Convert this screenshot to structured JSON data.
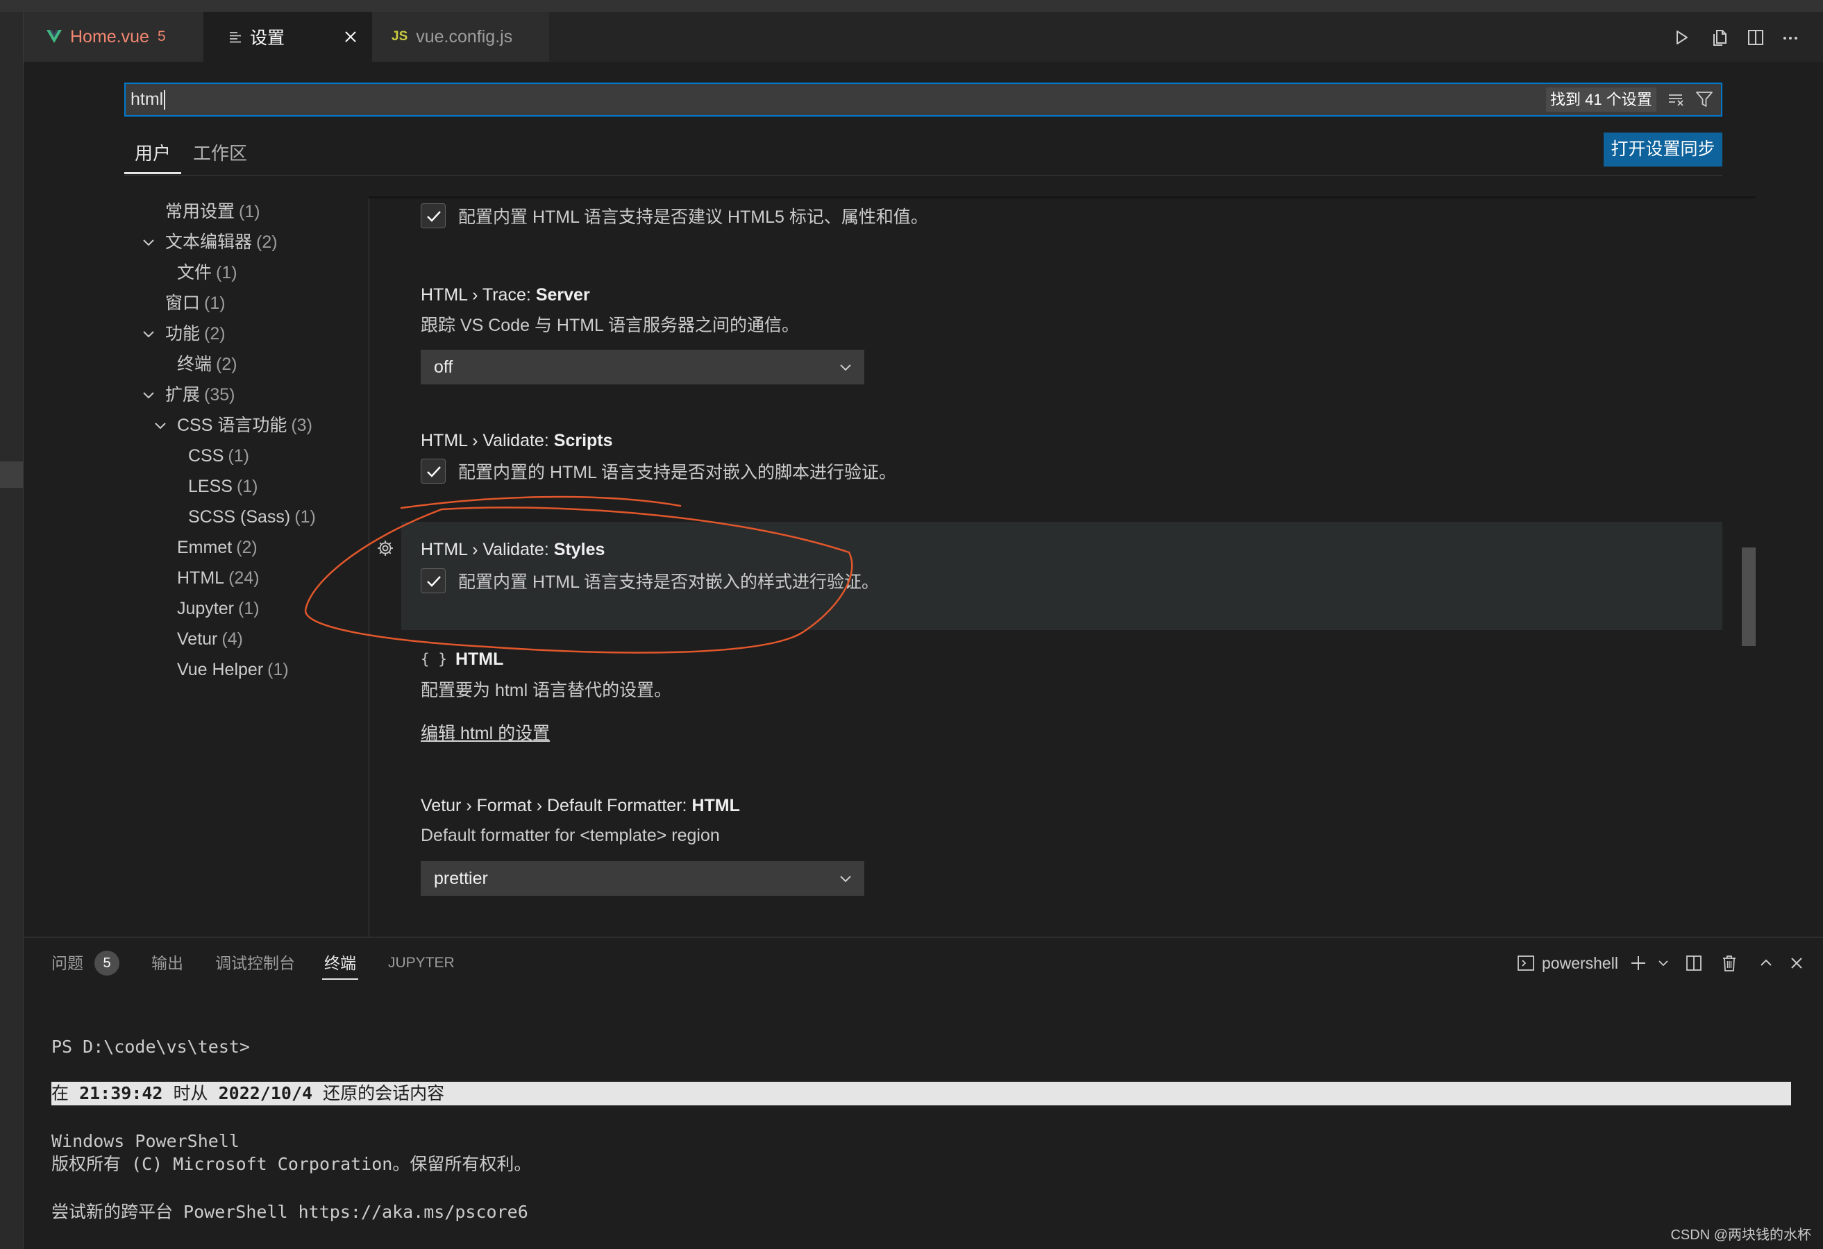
{
  "editor_tabs": [
    {
      "icon": "vue-icon",
      "label": "Home.vue",
      "problems": "5"
    },
    {
      "icon": "settings-list-icon",
      "label": "设置"
    },
    {
      "icon": "js-icon",
      "icon_text": "JS",
      "label": "vue.config.js"
    }
  ],
  "editor_actions": [
    "run-icon",
    "open-settings-json-icon",
    "split-editor-icon",
    "more-actions-icon"
  ],
  "search": {
    "value": "html",
    "result_count": "找到 41 个设置",
    "actions": [
      "clear-filter-icon",
      "filter-icon"
    ]
  },
  "scope_tabs": {
    "active_index": 0,
    "items": [
      "用户",
      "工作区"
    ]
  },
  "sync_button": {
    "label": "打开设置同步"
  },
  "toc": [
    {
      "label": "常用设置",
      "count": "(1)"
    },
    {
      "label": "文本编辑器",
      "count": "(2)",
      "expanded": true
    },
    {
      "label": "文件",
      "count": "(1)"
    },
    {
      "label": "窗口",
      "count": "(1)"
    },
    {
      "label": "功能",
      "count": "(2)",
      "expanded": true
    },
    {
      "label": "终端",
      "count": "(2)"
    },
    {
      "label": "扩展",
      "count": "(35)",
      "expanded": true
    },
    {
      "label": "CSS 语言功能",
      "count": "(3)",
      "expanded": true
    },
    {
      "label": "CSS",
      "count": "(1)"
    },
    {
      "label": "LESS",
      "count": "(1)"
    },
    {
      "label": "SCSS (Sass)",
      "count": "(1)"
    },
    {
      "label": "Emmet",
      "count": "(2)"
    },
    {
      "label": "HTML",
      "count": "(24)"
    },
    {
      "label": "Jupyter",
      "count": "(1)"
    },
    {
      "label": "Vetur",
      "count": "(4)"
    },
    {
      "label": "Vue Helper",
      "count": "(1)"
    }
  ],
  "settings": [
    {
      "description": "配置内置 HTML 语言支持是否建议 HTML5 标记、属性和值。",
      "checked": true
    },
    {
      "category": "HTML › Trace:",
      "key": "Server",
      "description": "跟踪 VS Code 与 HTML 语言服务器之间的通信。",
      "value": "off"
    },
    {
      "category": "HTML › Validate:",
      "key": "Scripts",
      "description": "配置内置的 HTML 语言支持是否对嵌入的脚本进行验证。",
      "checked": true
    },
    {
      "category": "HTML › Validate:",
      "key": "Styles",
      "description": "配置内置 HTML 语言支持是否对嵌入的样式进行验证。",
      "checked": true,
      "hovered": true
    },
    {
      "braces": "{ }",
      "key": "HTML",
      "description": "配置要为 html 语言替代的设置。",
      "link": "编辑 html 的设置"
    },
    {
      "category": "Vetur › Format › Default Formatter:",
      "key": "HTML",
      "description": "Default formatter for <template> region",
      "value": "prettier"
    }
  ],
  "panel": {
    "tabs": [
      {
        "label": "问题",
        "badge": "5"
      },
      {
        "label": "输出"
      },
      {
        "label": "调试控制台"
      },
      {
        "label": "终端",
        "active": true
      },
      {
        "label": "JUPYTER"
      }
    ],
    "terminal_profile": "powershell",
    "actions": [
      "terminal-icon",
      "add-terminal-icon",
      "terminal-dropdown-icon",
      "split-terminal-icon",
      "trash-icon",
      "maximize-panel-icon",
      "close-panel-icon"
    ]
  },
  "terminal": {
    "prompt": "PS D:\\code\\vs\\test>",
    "restored_notice": [
      "在 ",
      "21:39:42",
      " 时从 ",
      "2022/10/4",
      " 还原的会话内容"
    ],
    "lines": [
      "Windows PowerShell",
      "版权所有 (C) Microsoft Corporation。保留所有权利。",
      "尝试新的跨平台 PowerShell https://aka.ms/pscore6"
    ]
  },
  "watermark": "CSDN @两块钱的水杯",
  "colors": {
    "background": "#1e1e1e",
    "accent": "#007acc",
    "button": "#0e639c",
    "problem_tab": "#f48771",
    "vue_green": "#42b883",
    "js_yellow": "#cbcb41",
    "annotation": "#e2572b",
    "hover_row": "#2a2d2e"
  }
}
